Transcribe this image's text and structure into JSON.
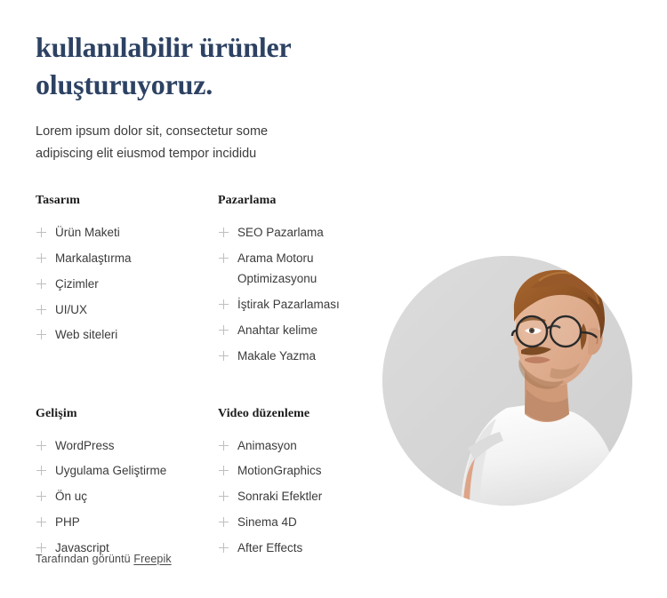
{
  "hero": {
    "title_line1": "kullanılabilir ürünler",
    "title_line2": "oluşturuyoruz.",
    "subtitle_line1": "Lorem ipsum dolor sit, consectetur some",
    "subtitle_line2": "adipiscing elit eiusmod tempor incididu",
    "title_color": "#2d4263"
  },
  "columns": [
    {
      "title": "Tasarım",
      "items": [
        {
          "label": "Ürün Maketi"
        },
        {
          "label": "Markalaştırma"
        },
        {
          "label": "Çizimler"
        },
        {
          "label": "UI/UX"
        },
        {
          "label": "Web siteleri"
        }
      ]
    },
    {
      "title": "Pazarlama",
      "items": [
        {
          "label": "SEO Pazarlama"
        },
        {
          "label": "Arama Motoru",
          "label2": "Optimizasyonu"
        },
        {
          "label": "İştirak Pazarlaması"
        },
        {
          "label": "Anahtar kelime"
        },
        {
          "label": "Makale Yazma"
        }
      ]
    },
    {
      "title": "Gelişim",
      "items": [
        {
          "label": "WordPress"
        },
        {
          "label": "Uygulama Geliştirme"
        },
        {
          "label": "Ön uç"
        },
        {
          "label": "PHP"
        },
        {
          "label": "Javascript"
        }
      ]
    },
    {
      "title": "Video düzenleme",
      "items": [
        {
          "label": "Animasyon"
        },
        {
          "label": "MotionGraphics"
        },
        {
          "label": "Sonraki Efektler"
        },
        {
          "label": "Sinema 4D"
        },
        {
          "label": "After Effects"
        }
      ]
    }
  ],
  "photo": {
    "alt": "man-with-glasses-portrait",
    "background_color": "#d6d6d6",
    "shape": "circle"
  },
  "credit": {
    "prefix": "Tarafından görüntü",
    "link_label": "Freepik"
  }
}
